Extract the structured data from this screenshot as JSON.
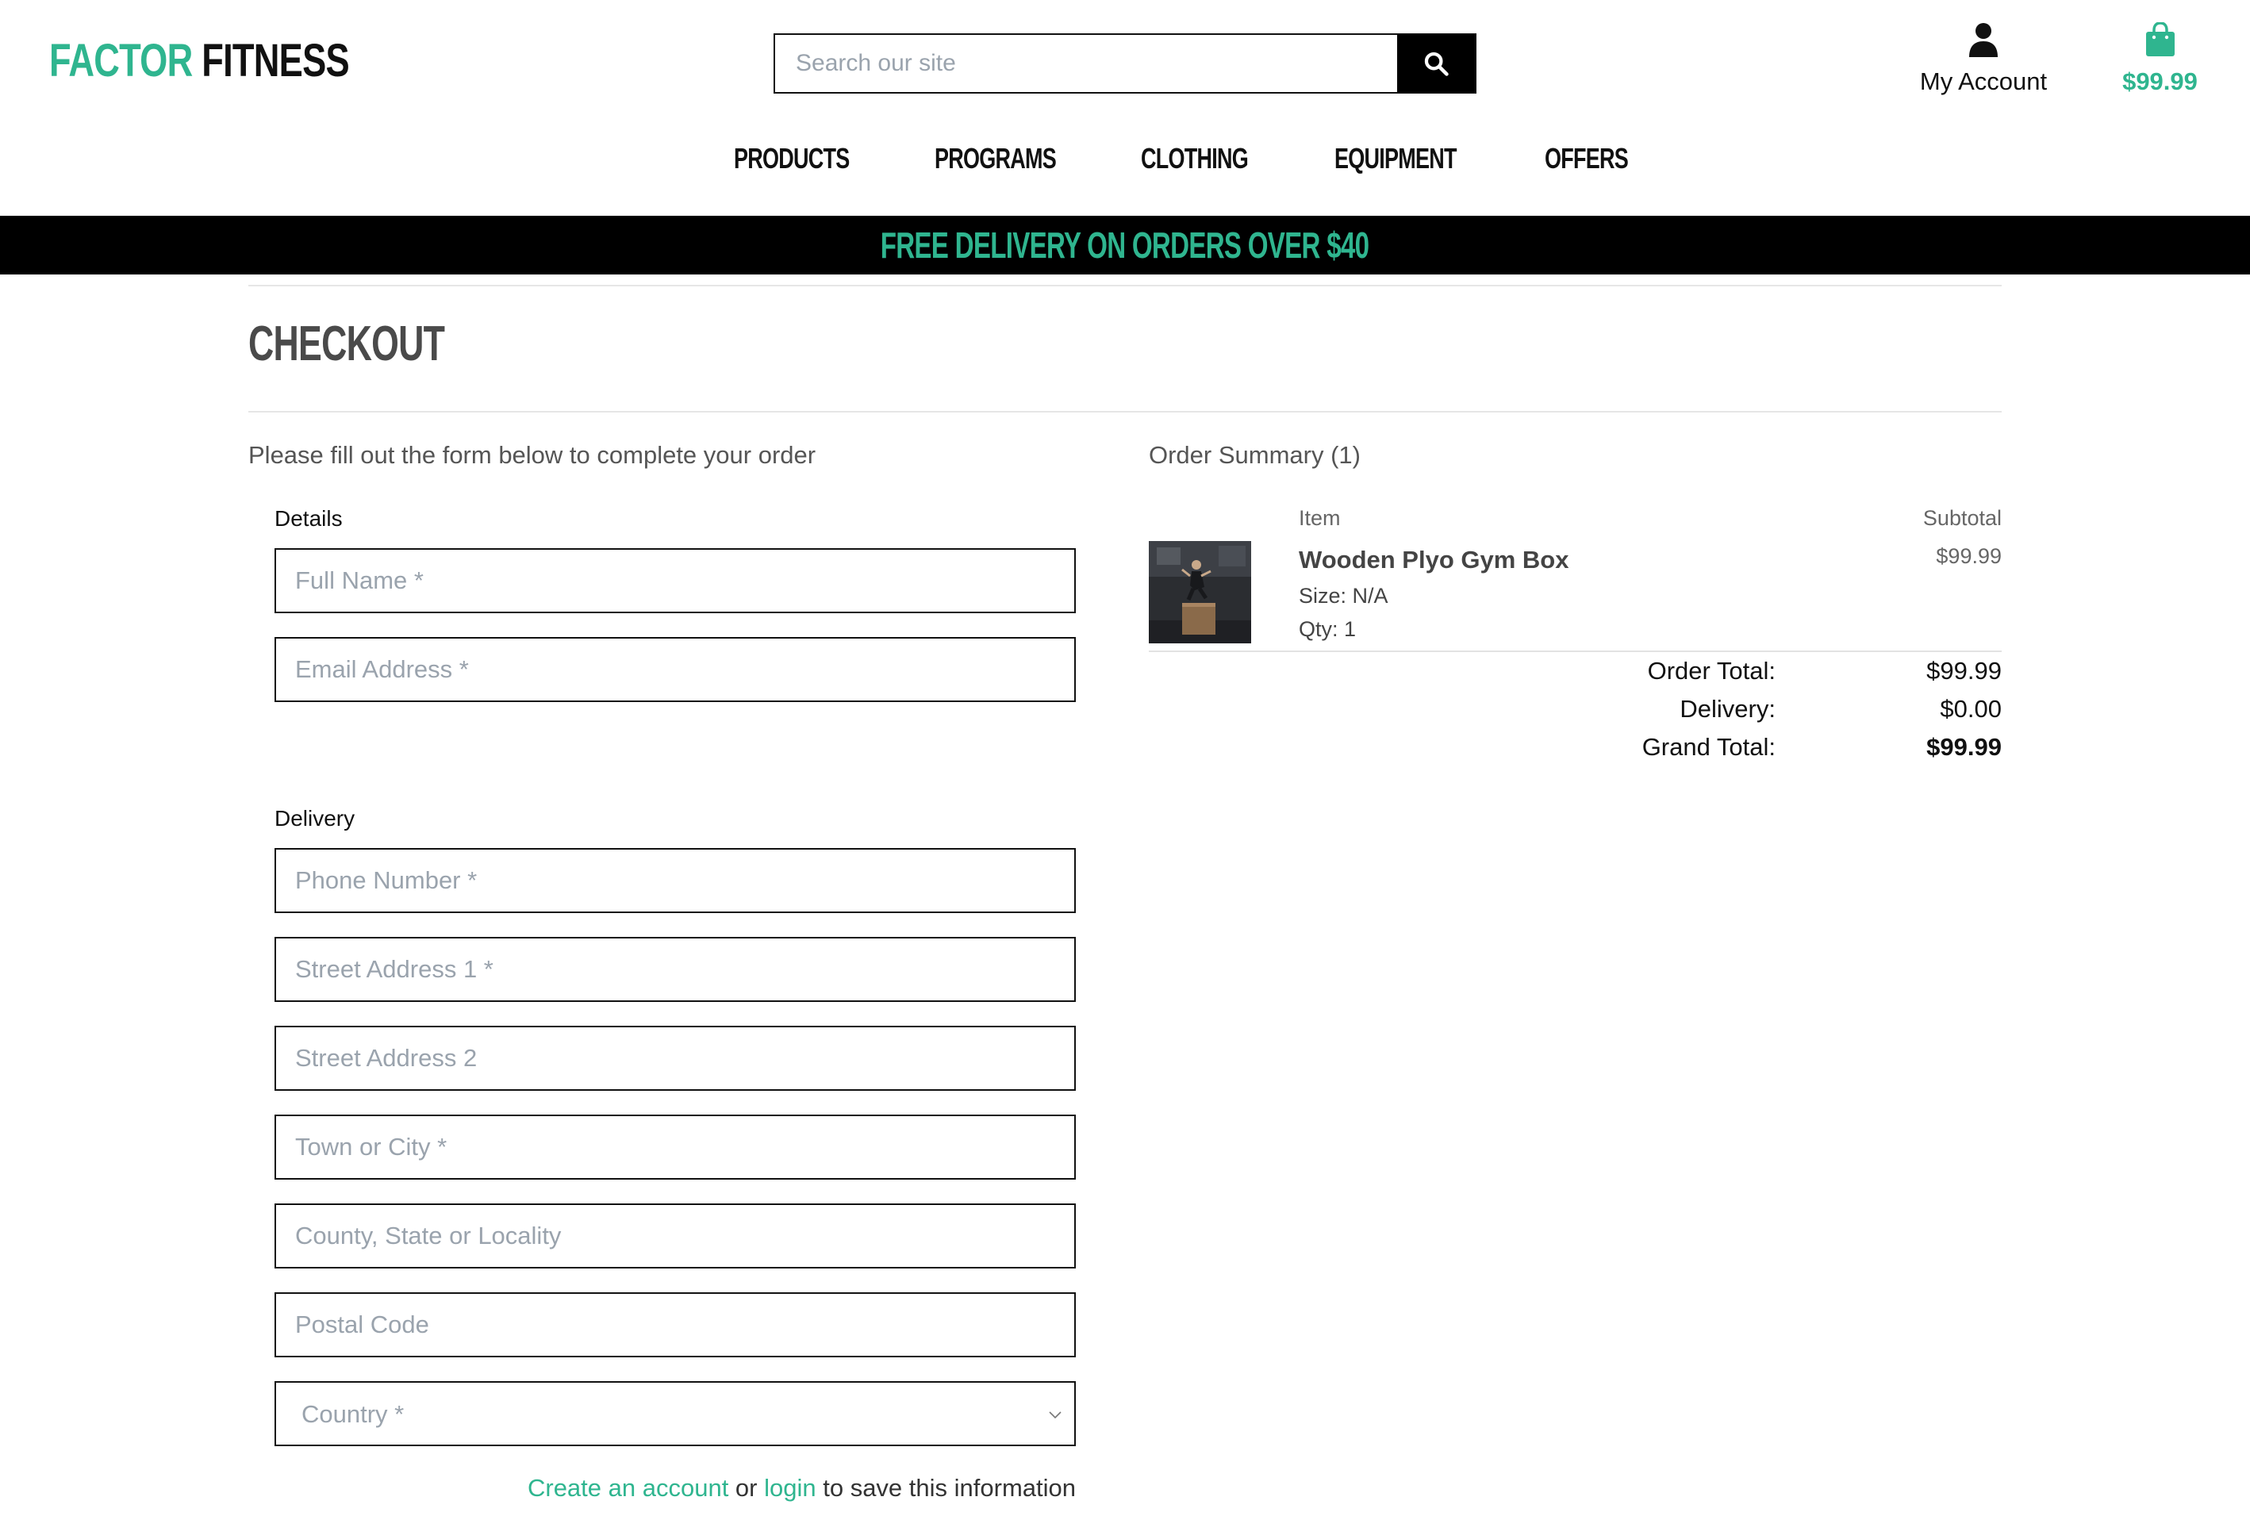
{
  "brand": {
    "part1": "FACTOR",
    "part2": "FITNESS",
    "green": "#2fb58f"
  },
  "search": {
    "placeholder": "Search our site",
    "icon": "search-icon"
  },
  "account": {
    "label": "My Account",
    "icon": "user-icon"
  },
  "cart": {
    "total": "$99.99",
    "icon": "shopping-bag-icon"
  },
  "nav": [
    "PRODUCTS",
    "PROGRAMS",
    "CLOTHING",
    "EQUIPMENT",
    "OFFERS"
  ],
  "banner": "FREE DELIVERY ON ORDERS OVER $40",
  "page": {
    "title": "CHECKOUT",
    "intro": "Please fill out the form below to complete your order"
  },
  "form": {
    "details_label": "Details",
    "delivery_label": "Delivery",
    "full_name": "Full Name *",
    "email": "Email Address *",
    "phone": "Phone Number *",
    "street1": "Street Address 1 *",
    "street2": "Street Address 2",
    "town": "Town or City *",
    "county": "County, State or Locality",
    "postcode": "Postal Code",
    "country": "Country *",
    "save_create": "Create an account",
    "save_or": " or ",
    "save_login": "login",
    "save_rest": " to save this information"
  },
  "summary": {
    "title": "Order Summary (1)",
    "col_item": "Item",
    "col_subtotal": "Subtotal",
    "item": {
      "name": "Wooden Plyo Gym Box",
      "size": "Size: N/A",
      "qty": "Qty: 1",
      "subtotal": "$99.99"
    },
    "order_total_label": "Order Total:",
    "order_total": "$99.99",
    "delivery_label": "Delivery:",
    "delivery": "$0.00",
    "grand_total_label": "Grand Total:",
    "grand_total": "$99.99"
  }
}
